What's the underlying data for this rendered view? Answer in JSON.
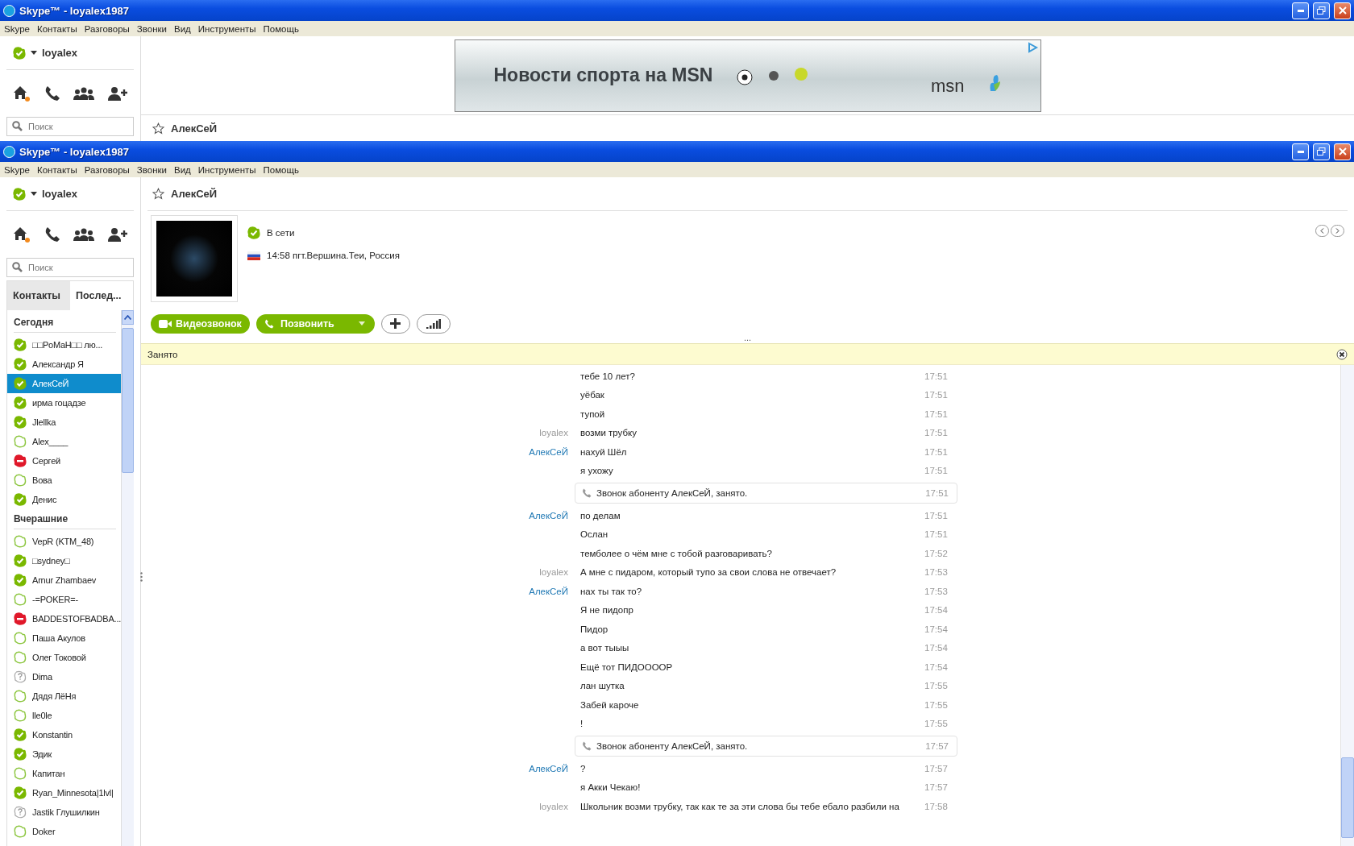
{
  "background_window": {
    "title": "Skype™ - loyalex1987",
    "menu": [
      "Skype",
      "Контакты",
      "Разговоры",
      "Звонки",
      "Вид",
      "Инструменты",
      "Помощь"
    ],
    "user": "loyalex",
    "search": {
      "placeholder": "Поиск"
    },
    "ad": {
      "headline": "Новости спорта на MSN",
      "brand": "msn"
    },
    "contact_name": "АлекСеЙ"
  },
  "main_window": {
    "title": "Skype™ - loyalex1987",
    "menu": [
      "Skype",
      "Контакты",
      "Разговоры",
      "Звонки",
      "Вид",
      "Инструменты",
      "Помощь"
    ],
    "user": "loyalex",
    "search": {
      "placeholder": "Поиск"
    },
    "tabs": [
      {
        "label": "Контакты",
        "selected": false
      },
      {
        "label": "Послед...",
        "selected": true
      }
    ],
    "contact_groups": [
      {
        "title": "Сегодня",
        "contacts": [
          {
            "name": "□□PoMaH□□ лю...",
            "kind": "online",
            "selected": false
          },
          {
            "name": "Александр Я",
            "kind": "online",
            "selected": false
          },
          {
            "name": "АлекСеЙ",
            "kind": "online",
            "selected": true
          },
          {
            "name": "ирма гоцадзе",
            "kind": "online",
            "selected": false
          },
          {
            "name": "Jlellka",
            "kind": "online",
            "selected": false
          },
          {
            "name": "Alex____",
            "kind": "offline",
            "selected": false
          },
          {
            "name": "Сергей",
            "kind": "busy",
            "selected": false
          },
          {
            "name": "Вова",
            "kind": "offline",
            "selected": false
          },
          {
            "name": "Денис",
            "kind": "online",
            "selected": false
          }
        ]
      },
      {
        "title": "Вчерашние",
        "contacts": [
          {
            "name": "VepR (KTM_48)",
            "kind": "offline",
            "selected": false
          },
          {
            "name": "□sydney□",
            "kind": "online",
            "selected": false
          },
          {
            "name": "Arnur Zhambaev",
            "kind": "online",
            "selected": false
          },
          {
            "name": "-=POKER=-",
            "kind": "offline",
            "selected": false
          },
          {
            "name": "BADDESTOFBADBA...",
            "kind": "busy",
            "selected": false
          },
          {
            "name": "Паша Акулов",
            "kind": "offline",
            "selected": false
          },
          {
            "name": "Олег Токовой",
            "kind": "offline",
            "selected": false
          },
          {
            "name": "Dima",
            "kind": "unknown",
            "selected": false
          },
          {
            "name": "Дядя ЛёНя",
            "kind": "offline",
            "selected": false
          },
          {
            "name": "lle0le",
            "kind": "offline",
            "selected": false
          },
          {
            "name": "Konstantin",
            "kind": "online",
            "selected": false
          },
          {
            "name": "Эдик",
            "kind": "online",
            "selected": false
          },
          {
            "name": "Капитан",
            "kind": "offline",
            "selected": false
          },
          {
            "name": "Ryan_Minnesota|1lvl|",
            "kind": "online",
            "selected": false
          },
          {
            "name": "Jastik Глушилкин",
            "kind": "unknown",
            "selected": false
          },
          {
            "name": "Doker",
            "kind": "offline",
            "selected": false
          }
        ]
      }
    ],
    "contact": {
      "name": "АлекСеЙ",
      "kind": "online",
      "status_text": "В сети",
      "location": "14:58 пгт.Вершина.Теи, Россия"
    },
    "actions": {
      "video_call": "Видеозвонок",
      "call": "Позвонить"
    },
    "ellipsis": "...",
    "notice": "Занято",
    "messages": [
      {
        "kind": "message",
        "text": "тебе 10 лет?",
        "time": "17:51"
      },
      {
        "kind": "message",
        "text": "уёбак",
        "time": "17:51"
      },
      {
        "kind": "message",
        "text": "тупой",
        "time": "17:51"
      },
      {
        "kind": "message",
        "sender": {
          "name": "loyalex",
          "kind": "self"
        },
        "text": "возми трубку",
        "time": "17:51"
      },
      {
        "kind": "message",
        "sender": {
          "name": "АлекСеЙ",
          "kind": "contact"
        },
        "text": "нахуй Шёл",
        "time": "17:51"
      },
      {
        "kind": "message",
        "text": "я ухожу",
        "time": "17:51"
      },
      {
        "kind": "call",
        "text": "Звонок абоненту АлекСеЙ, занято.",
        "time": "17:51"
      },
      {
        "kind": "message",
        "sender": {
          "name": "АлекСеЙ",
          "kind": "contact"
        },
        "text": "по делам",
        "time": "17:51"
      },
      {
        "kind": "message",
        "text": "Ослан",
        "time": "17:51"
      },
      {
        "kind": "message",
        "text": "темболее о чём мне с тобой разговаривать?",
        "time": "17:52"
      },
      {
        "kind": "message",
        "sender": {
          "name": "loyalex",
          "kind": "self"
        },
        "text": "А мне с пидаром, который тупо за свои слова не отвечает?",
        "time": "17:53"
      },
      {
        "kind": "message",
        "sender": {
          "name": "АлекСеЙ",
          "kind": "contact"
        },
        "text": "нах ты так то?",
        "time": "17:53"
      },
      {
        "kind": "message",
        "text": "Я не пидопр",
        "time": "17:54"
      },
      {
        "kind": "message",
        "text": "Пидор",
        "time": "17:54"
      },
      {
        "kind": "message",
        "text": "а вот тыыы",
        "time": "17:54"
      },
      {
        "kind": "message",
        "text": "Ещё тот ПИДОООOР",
        "time": "17:54"
      },
      {
        "kind": "message",
        "text": "лан шутка",
        "time": "17:55"
      },
      {
        "kind": "message",
        "text": "Забей кароче",
        "time": "17:55"
      },
      {
        "kind": "message",
        "text": "!",
        "time": "17:55"
      },
      {
        "kind": "call",
        "text": "Звонок абоненту АлекСеЙ, занято.",
        "time": "17:57"
      },
      {
        "kind": "message",
        "sender": {
          "name": "АлекСеЙ",
          "kind": "contact"
        },
        "text": "?",
        "time": "17:57"
      },
      {
        "kind": "message",
        "text": "я Акки Чекаю!",
        "time": "17:57"
      },
      {
        "kind": "message",
        "sender": {
          "name": "loyalex",
          "kind": "self"
        },
        "text": "Школьник возми трубку, так как те за эти слова бы тебе ебало разбили на",
        "time": "17:58"
      }
    ]
  }
}
